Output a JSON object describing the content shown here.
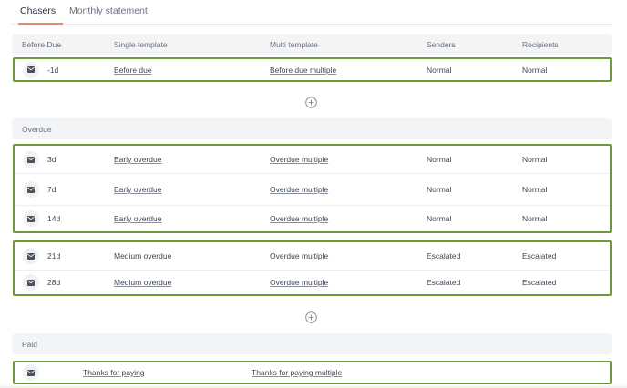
{
  "tabs": [
    {
      "label": "Chasers",
      "active": true
    },
    {
      "label": "Monthly statement",
      "active": false
    }
  ],
  "columns": {
    "before_due": "Before Due",
    "single_template": "Single template",
    "multi_template": "Multi template",
    "senders": "Senders",
    "recipients": "Recipients"
  },
  "sections": {
    "overdue": "Overdue",
    "paid": "Paid"
  },
  "before_due_rows": [
    {
      "offset": "-1d",
      "single": "Before due",
      "multi": "Before due multiple",
      "senders": "Normal",
      "recipients": "Normal"
    }
  ],
  "overdue_group1": [
    {
      "offset": "3d",
      "single": "Early overdue",
      "multi": "Overdue multiple",
      "senders": "Normal",
      "recipients": "Normal"
    },
    {
      "offset": "7d",
      "single": "Early overdue",
      "multi": "Overdue multiple",
      "senders": "Normal",
      "recipients": "Normal"
    },
    {
      "offset": "14d",
      "single": "Early overdue",
      "multi": "Overdue multiple",
      "senders": "Normal",
      "recipients": "Normal"
    }
  ],
  "overdue_group2": [
    {
      "offset": "21d",
      "single": "Medium overdue",
      "multi": "Overdue multiple",
      "senders": "Escalated",
      "recipients": "Escalated"
    },
    {
      "offset": "28d",
      "single": "Medium overdue",
      "multi": "Overdue multiple",
      "senders": "Escalated",
      "recipients": "Escalated"
    }
  ],
  "paid_rows": [
    {
      "single": "Thanks for paying",
      "multi": "Thanks for paying multiple"
    }
  ],
  "icons": {
    "row_icon": "mail-icon",
    "add_icon": "add-circle-icon"
  },
  "colors": {
    "group_border": "#6f9a3a",
    "active_tab_underline": "#e08a72",
    "section_bg": "#f3f4f6"
  }
}
